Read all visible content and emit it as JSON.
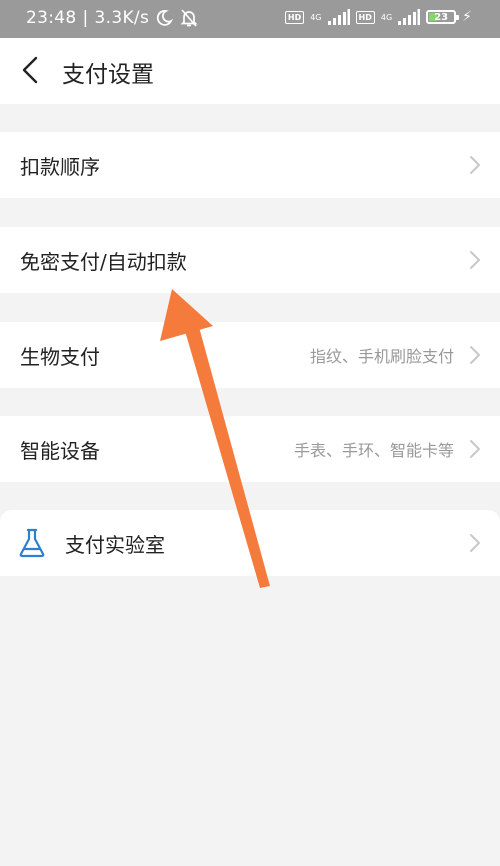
{
  "status_bar": {
    "time": "23:48",
    "speed": "3.3K/s",
    "sim1_hd": "HD",
    "sim1_net": "4G",
    "sim2_hd": "HD",
    "sim2_net": "4G",
    "battery": "23",
    "icons": [
      "moon-icon",
      "bell-off-icon",
      "signal-icon",
      "signal-icon",
      "battery-icon",
      "charging-icon"
    ]
  },
  "header": {
    "title": "支付设置",
    "back_icon": "chevron-left-icon"
  },
  "settings": {
    "rows": [
      {
        "label": "扣款顺序",
        "sub": ""
      },
      {
        "label": "免密支付/自动扣款",
        "sub": ""
      },
      {
        "label": "生物支付",
        "sub": "指纹、手机刷脸支付"
      },
      {
        "label": "智能设备",
        "sub": "手表、手环、智能卡等"
      },
      {
        "label": "支付实验室",
        "sub": "",
        "icon": "flask-icon"
      }
    ]
  },
  "colors": {
    "background": "#f3f3f3",
    "status_bar": "#9a9a9a",
    "flask_icon": "#2f7fd0",
    "annotation_arrow": "#f57b3c",
    "battery_fill": "#8bd36e"
  },
  "annotation": {
    "type": "arrow",
    "icon": "arrow-annotation"
  }
}
